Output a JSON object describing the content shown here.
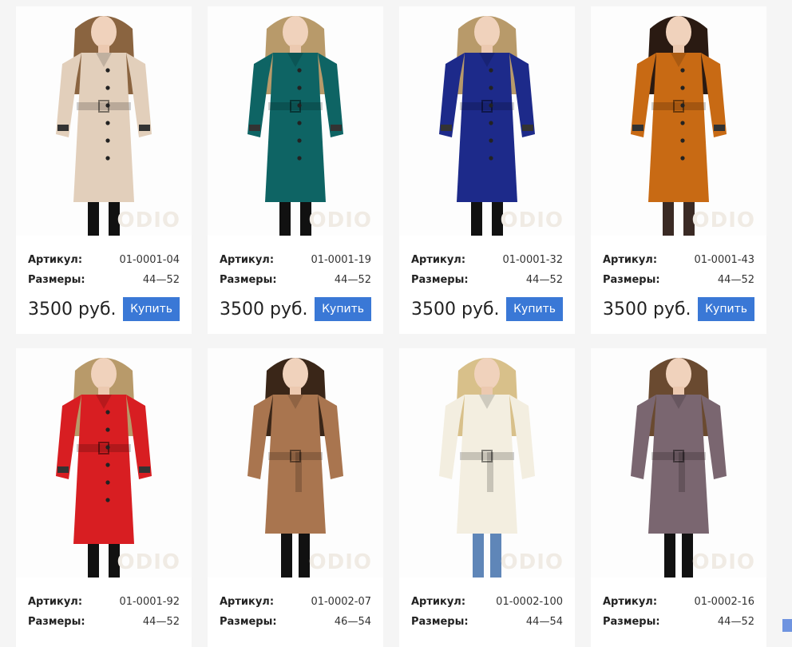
{
  "labels": {
    "article": "Артикул:",
    "sizes": "Размеры:",
    "buy": "Купить"
  },
  "watermark": "ODIO",
  "products": [
    {
      "article": "01-0001-04",
      "sizes": "44—52",
      "price": "3500 руб.",
      "coat": "#e2cfbb",
      "hair": "#8a6440",
      "legs": "#111111",
      "style": "trench"
    },
    {
      "article": "01-0001-19",
      "sizes": "44—52",
      "price": "3500 руб.",
      "coat": "#0e6464",
      "hair": "#b89a6a",
      "legs": "#111111",
      "style": "trench"
    },
    {
      "article": "01-0001-32",
      "sizes": "44—52",
      "price": "3500 руб.",
      "coat": "#1d2a8a",
      "hair": "#b89a6a",
      "legs": "#111111",
      "style": "trench"
    },
    {
      "article": "01-0001-43",
      "sizes": "44—52",
      "price": "3500 руб.",
      "coat": "#c86a14",
      "hair": "#2a1a12",
      "legs": "#3a2a24",
      "style": "trench"
    },
    {
      "article": "01-0001-92",
      "sizes": "44—52",
      "price": "",
      "coat": "#d81e22",
      "hair": "#b89a6a",
      "legs": "#111111",
      "style": "trench"
    },
    {
      "article": "01-0002-07",
      "sizes": "46—54",
      "price": "",
      "coat": "#a9754f",
      "hair": "#3a2618",
      "legs": "#111111",
      "style": "short"
    },
    {
      "article": "01-0002-100",
      "sizes": "44—54",
      "price": "",
      "coat": "#f3eee0",
      "hair": "#d8c08a",
      "legs": "#5f86b8",
      "style": "short"
    },
    {
      "article": "01-0002-16",
      "sizes": "44—52",
      "price": "",
      "coat": "#7a6670",
      "hair": "#6a4a30",
      "legs": "#111111",
      "style": "short"
    }
  ]
}
